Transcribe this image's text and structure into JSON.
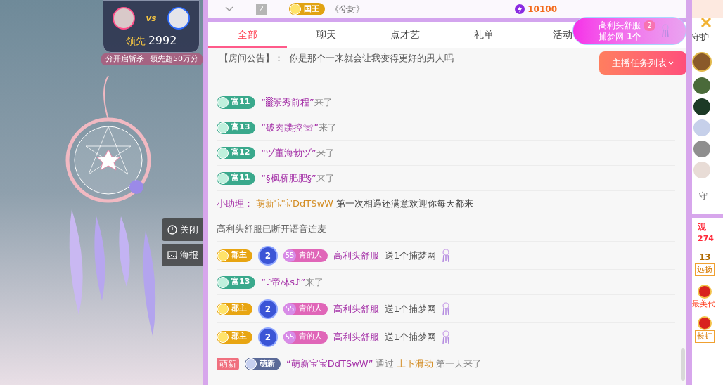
{
  "stream": {
    "pk": {
      "versus": "vs",
      "lead_label": "领先",
      "lead_score": "2992"
    },
    "banner": [
      "分开启斩杀",
      "领先超50万分"
    ],
    "buttons": [
      {
        "kind": "close",
        "label": "关闭"
      },
      {
        "kind": "poster",
        "label": "海报"
      }
    ]
  },
  "rank_row": {
    "rank": "2",
    "badge": "国王",
    "name": "《兮封》",
    "points": "10100"
  },
  "tabs": [
    {
      "label": "全部",
      "selected": true
    },
    {
      "label": "聊天",
      "selected": false
    },
    {
      "label": "点才艺",
      "selected": false
    },
    {
      "label": "礼单",
      "selected": false
    },
    {
      "label": "活动",
      "selected": false
    }
  ],
  "gift_popup": {
    "sender": "高利头舒服",
    "gift": "捕梦网",
    "count": "1个",
    "combo": "2"
  },
  "task_button": "主播任务列表",
  "announcement": {
    "label": "【房间公告】：",
    "text": "你是那个一来就会让我变得更好的男人吗"
  },
  "messages": [
    {
      "kind": "enter",
      "badge": "富11",
      "name": "“▒景秀前程”",
      "suffix": "来了"
    },
    {
      "kind": "enter",
      "badge": "富13",
      "name": "“破肉蹼控☏”",
      "suffix": "来了"
    },
    {
      "kind": "enter",
      "badge": "富12",
      "name": "“ヅ董海勃ヅ”",
      "suffix": "来了"
    },
    {
      "kind": "enter",
      "badge": "富11",
      "name": "“§枫桥肥肥§”",
      "suffix": "来了"
    },
    {
      "kind": "assistant",
      "label": "小助理：",
      "name": "萌新宝宝DdTSwW",
      "text": "第一次相遇还满意欢迎你每天都来"
    },
    {
      "kind": "system",
      "text": "高利头舒服已断开语音连麦"
    },
    {
      "kind": "gift",
      "title_badge": "郡主",
      "star": "2",
      "fan_level": "55",
      "fan_name": "青的人",
      "name": "高利头舒服",
      "action": "送1个捕梦网"
    },
    {
      "kind": "enter",
      "badge": "富13",
      "name": "“♪帝林s♪”",
      "suffix": "来了"
    },
    {
      "kind": "gift",
      "title_badge": "郡主",
      "star": "2",
      "fan_level": "55",
      "fan_name": "青的人",
      "name": "高利头舒服",
      "action": "送1个捕梦网"
    },
    {
      "kind": "gift",
      "title_badge": "郡主",
      "star": "2",
      "fan_level": "55",
      "fan_name": "青的人",
      "name": "高利头舒服",
      "action": "送1个捕梦网"
    },
    {
      "kind": "newbie",
      "tag": "萌新",
      "badge": "萌新",
      "name": "“萌新宝宝DdTSwW”",
      "via": "通过",
      "highlight": "上下滑动",
      "suffix": "第一天来了"
    }
  ],
  "side": {
    "guard_label": "守护",
    "guard_more": "守",
    "audience_label": "观",
    "audience_count": "274",
    "rank_level": "13",
    "rank_tag": "远扬",
    "beauty_label": "最美代",
    "streak_tag": "长虹"
  }
}
